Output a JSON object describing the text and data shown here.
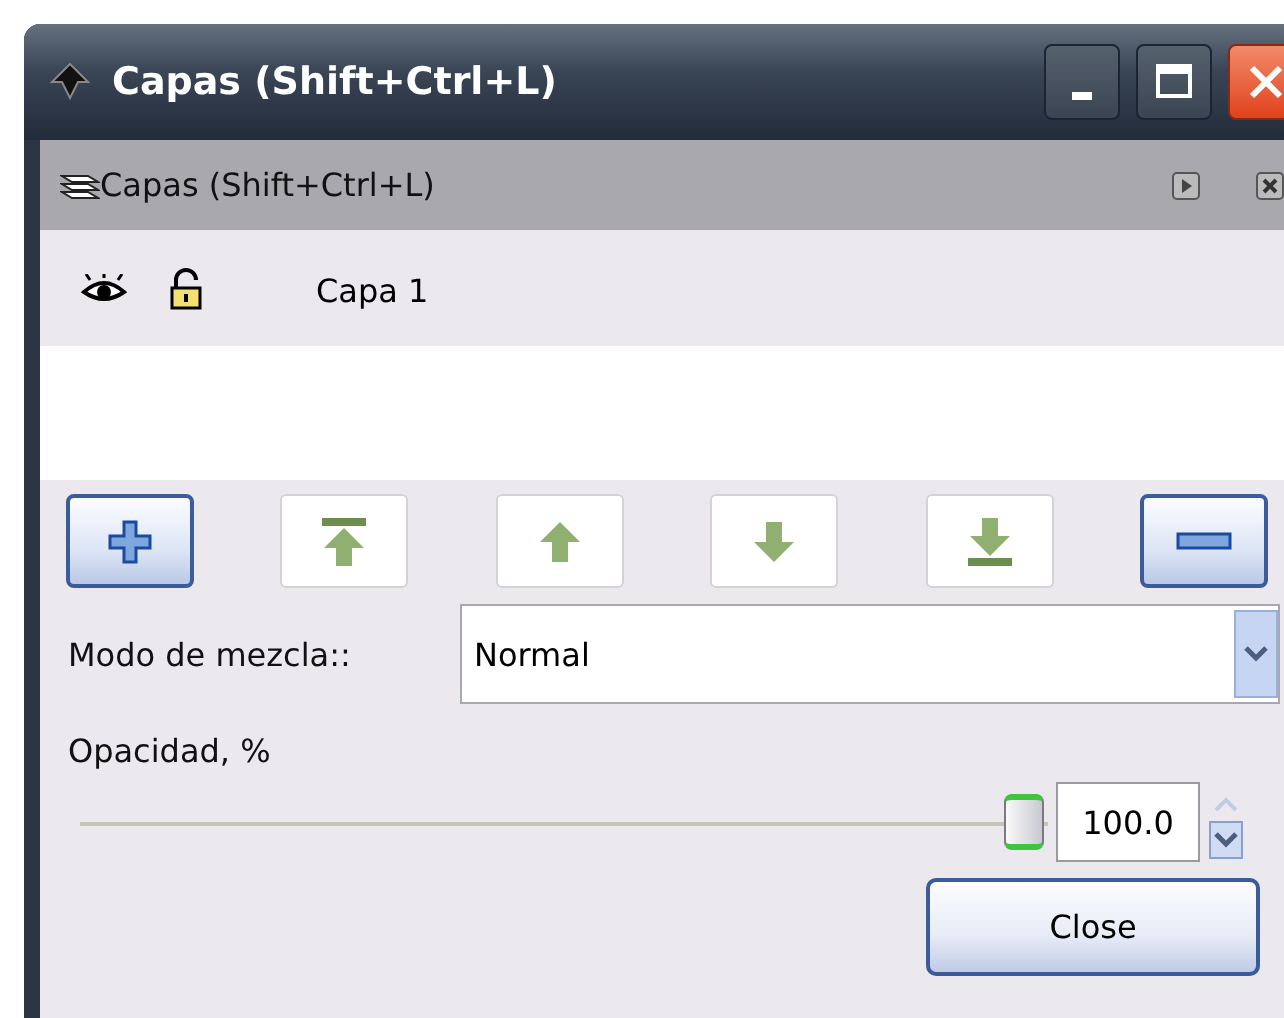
{
  "window": {
    "title": "Capas (Shift+Ctrl+L)",
    "controls": [
      {
        "kind": "minimize"
      },
      {
        "kind": "maximize"
      },
      {
        "kind": "close"
      }
    ]
  },
  "panel": {
    "title": "Capas (Shift+Ctrl+L)"
  },
  "layers": [
    {
      "name": "Capa 1",
      "visible": true,
      "locked": false
    }
  ],
  "toolbar": [
    {
      "kind": "add"
    },
    {
      "kind": "top"
    },
    {
      "kind": "up"
    },
    {
      "kind": "down"
    },
    {
      "kind": "bottom"
    },
    {
      "kind": "remove"
    }
  ],
  "blend": {
    "label": "Modo de mezcla::",
    "value": "Normal"
  },
  "opacity": {
    "label": "Opacidad, %",
    "level": 1,
    "value": "100.0"
  },
  "buttons": [
    "Close"
  ]
}
